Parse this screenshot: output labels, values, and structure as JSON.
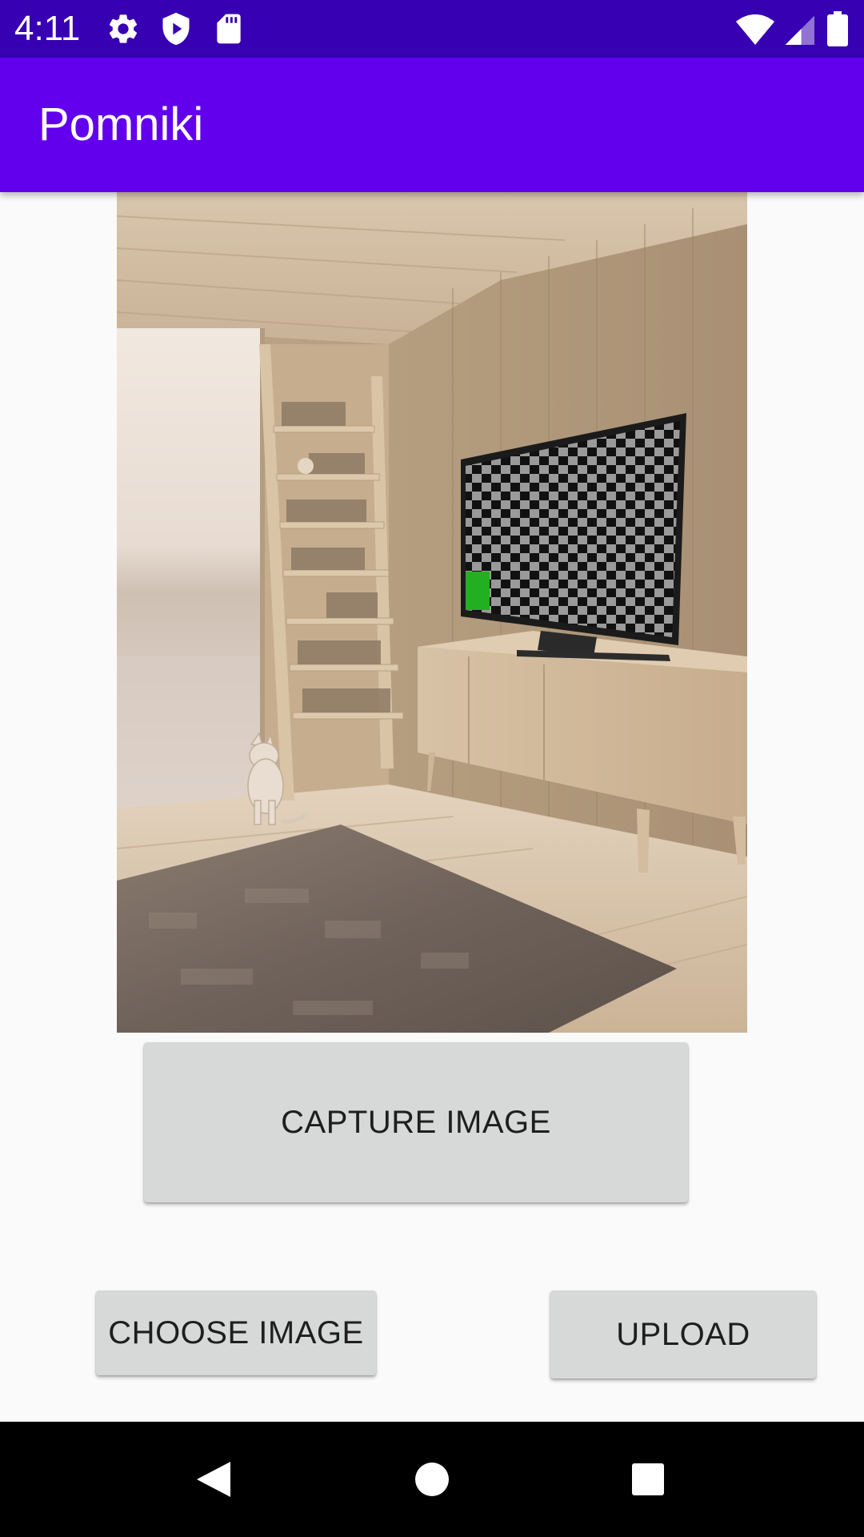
{
  "status_bar": {
    "time": "4:11",
    "background": "#3700b3",
    "left_icons": [
      "settings-gear-icon",
      "shield-play-icon",
      "sd-card-icon"
    ],
    "right_icons": [
      "wifi-icon",
      "cell-signal-icon",
      "battery-icon"
    ]
  },
  "app_bar": {
    "title": "Pomniki",
    "background": "#6200ee"
  },
  "preview": {
    "description_icon": "captured-photo"
  },
  "buttons": {
    "capture_label": "CAPTURE IMAGE",
    "choose_label": "CHOOSE IMAGE",
    "upload_label": "UPLOAD"
  },
  "nav_bar": {
    "icons": [
      "back-icon",
      "home-icon",
      "recents-icon"
    ]
  }
}
